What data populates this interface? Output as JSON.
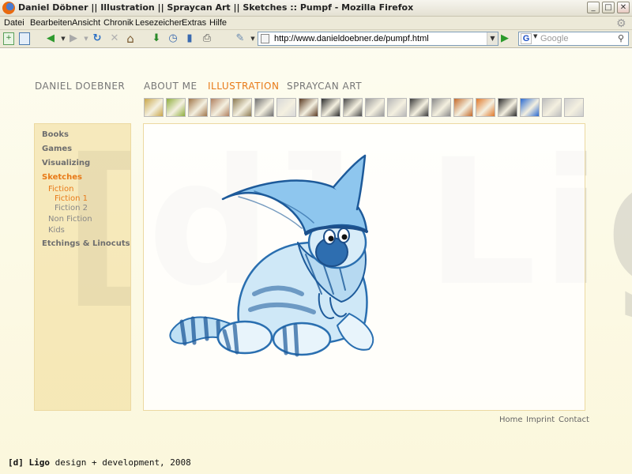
{
  "window": {
    "title": "Daniel Döbner || Illustration || Spraycan Art || Sketches :: Pumpf - Mozilla Firefox",
    "minimize": "_",
    "maximize": "□",
    "close": "✕"
  },
  "menu": [
    "Datei",
    "Bearbeiten",
    "Ansicht",
    "Chronik",
    "Lesezeichen",
    "Extras",
    "Hilfe"
  ],
  "toolbar": {
    "url": "http://www.danieldoebner.de/pumpf.html",
    "search_placeholder": "Google",
    "search_engine_letter": "G"
  },
  "icons": {
    "back": "◀",
    "forward": "▶",
    "reload": "↻",
    "stop": "✕",
    "home": "⌂",
    "go": "▶",
    "search": "⚲",
    "throbber": "⚙",
    "dropdown": "▼"
  },
  "site": {
    "brand": "DANIEL DOEBNER",
    "nav": [
      {
        "label": "ABOUT ME",
        "active": false
      },
      {
        "label": "ILLUSTRATION",
        "active": true
      },
      {
        "label": "SPRAYCAN ART",
        "active": false
      }
    ],
    "thumb_colors": [
      "#c9a64a",
      "#8fae3e",
      "#a0764a",
      "#b08060",
      "#8c7a52",
      "#6f6f6f",
      "#d8d8d8",
      "#5a3a22",
      "#2c2c2c",
      "#4a4a4a",
      "#9a9a9a",
      "#b8b8b8",
      "#3a3a3a",
      "#8a8a8a",
      "#c46a2a",
      "#e0782a",
      "#2a2a2a",
      "#2a6ad0",
      "#bdbdbd",
      "#cfcfcf"
    ],
    "sidebar": [
      {
        "label": "Books",
        "level": 0,
        "active": false
      },
      {
        "label": "Games",
        "level": 0,
        "active": false
      },
      {
        "label": "Visualizing",
        "level": 0,
        "active": false
      },
      {
        "label": "Sketches",
        "level": 0,
        "active": true
      },
      {
        "label": "Fiction",
        "level": 1,
        "active": true
      },
      {
        "label": "Fiction 1",
        "level": 2,
        "active": true
      },
      {
        "label": "Fiction 2",
        "level": 2,
        "active": false
      },
      {
        "label": "Non Fiction",
        "level": 1,
        "active": false
      },
      {
        "label": "Kids",
        "level": 1,
        "active": false
      },
      {
        "label": "Etchings & Linocuts",
        "level": 0,
        "active": false
      }
    ],
    "watermark": "[d] Ligo",
    "footer_links": [
      "Home",
      "Imprint",
      "Contact"
    ],
    "credit_mark": "[d] Ligo",
    "credit_text": "design + development, 2008"
  },
  "colors": {
    "accent": "#e87a18",
    "sketch_blue": "#3d8fd0"
  }
}
